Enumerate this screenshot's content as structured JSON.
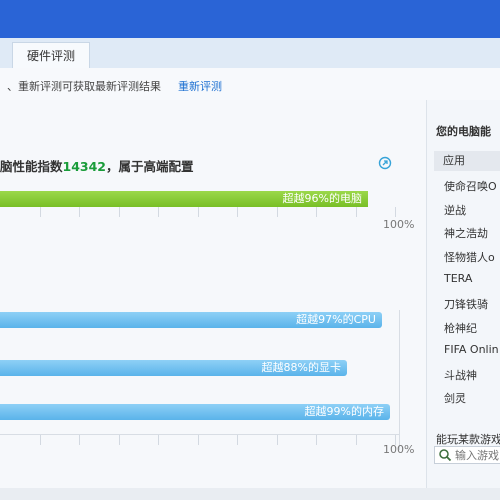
{
  "tabs": [
    {
      "label": "硬件评测"
    }
  ],
  "notice": {
    "text": "、重新评测可获取最新评测结果",
    "link": "重新评测"
  },
  "score": {
    "prefix": "脑性能指数",
    "value": "14342",
    "suffix": "，属于高端配置"
  },
  "overall_bar": {
    "label": "超越96%的电脑",
    "percent": 96,
    "scale_max_label": "100%"
  },
  "component_bars": [
    {
      "label": "超越97%的CPU",
      "percent": 97
    },
    {
      "label": "超越88%的显卡",
      "percent": 88
    },
    {
      "label": "超越99%的内存",
      "percent": 99
    }
  ],
  "component_scale_max_label": "100%",
  "sidebar": {
    "title": "您的电脑能",
    "header": "应用",
    "items": [
      "使命召唤O",
      "逆战",
      "神之浩劫",
      "怪物猎人o",
      "TERA",
      "刀锋铁骑",
      "枪神纪",
      "FIFA Onlin",
      "斗战神",
      "剑灵"
    ],
    "bottom_label": "能玩某款游戏",
    "search_placeholder": "输入游戏"
  },
  "colors": {
    "titlebar": "#2a64d6",
    "green_bar": "#86c83a",
    "blue_bar": "#6cbcf0",
    "score_value": "#1a9c3a",
    "link": "#1c6fd1"
  },
  "icons": {
    "refresh": "refresh-icon",
    "search": "search-icon"
  }
}
